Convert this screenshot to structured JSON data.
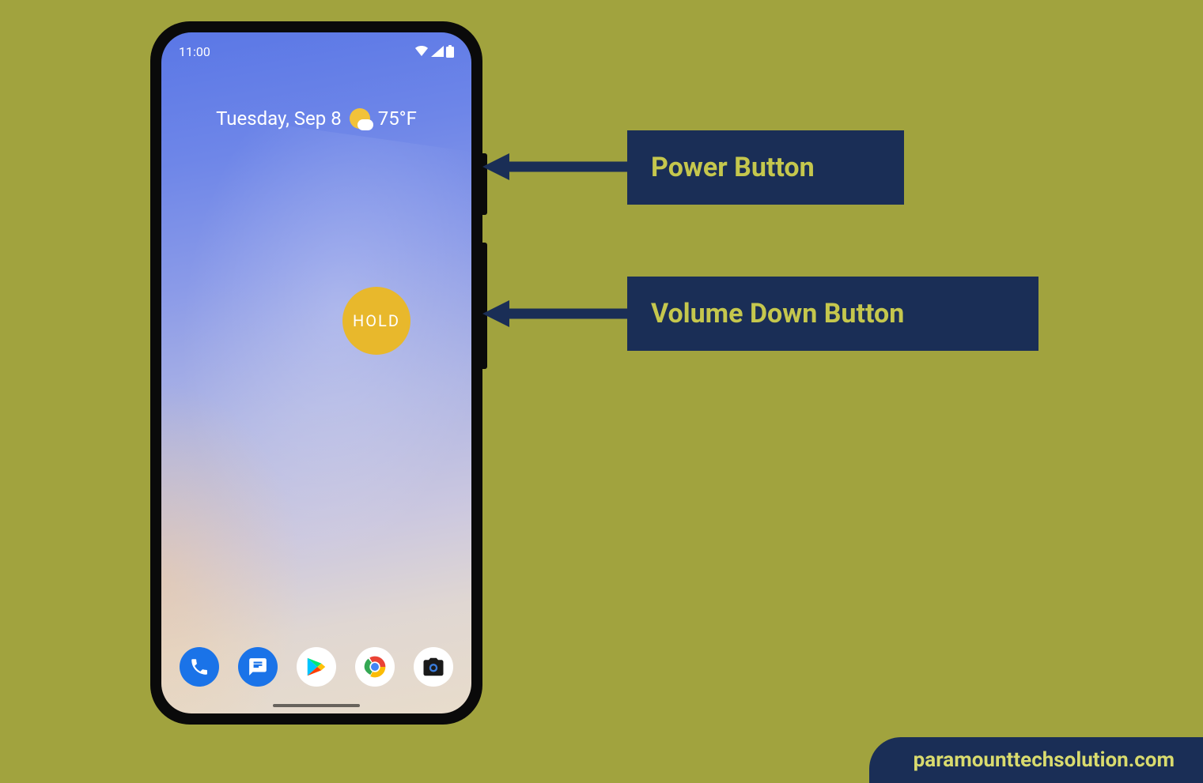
{
  "statusBar": {
    "time": "11:00"
  },
  "weather": {
    "day": "Tuesday, Sep 8",
    "temp": "75°F"
  },
  "hold": {
    "label": "HOLD"
  },
  "dock": {
    "phone": "phone-app-icon",
    "messages": "messages-app-icon",
    "play": "play-store-icon",
    "chrome": "chrome-icon",
    "camera": "camera-icon"
  },
  "labels": {
    "power": "Power Button",
    "volume": "Volume Down Button"
  },
  "watermark": "paramounttechsolution.com"
}
